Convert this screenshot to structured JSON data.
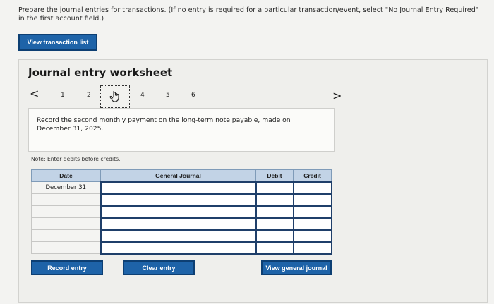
{
  "instructions": {
    "line1": "Prepare the journal entries for transactions. (If no entry is required for a particular transaction/event, select \"No Journal Entry Required\"",
    "line2": "in the first account field.)"
  },
  "buttons": {
    "view_transaction_list": "View transaction list",
    "record_entry": "Record entry",
    "clear_entry": "Clear entry",
    "view_general_journal": "View general journal"
  },
  "worksheet": {
    "title": "Journal entry worksheet",
    "prev": "<",
    "next": ">",
    "steps": [
      "1",
      "2",
      "3",
      "4",
      "5",
      "6"
    ],
    "current_step": "3",
    "question": "Record the second monthly payment on the long-term note payable, made on December 31, 2025.",
    "note": "Note: Enter debits before credits."
  },
  "journal": {
    "headers": {
      "date": "Date",
      "account": "General Journal",
      "debit": "Debit",
      "credit": "Credit"
    },
    "rows": [
      {
        "date": "December 31",
        "account": "",
        "debit": "",
        "credit": ""
      },
      {
        "date": "",
        "account": "",
        "debit": "",
        "credit": ""
      },
      {
        "date": "",
        "account": "",
        "debit": "",
        "credit": ""
      },
      {
        "date": "",
        "account": "",
        "debit": "",
        "credit": ""
      },
      {
        "date": "",
        "account": "",
        "debit": "",
        "credit": ""
      },
      {
        "date": "",
        "account": "",
        "debit": "",
        "credit": ""
      }
    ]
  },
  "icons": {
    "current_step": "pointer-hand-icon"
  },
  "colors": {
    "button": "#1e63a8",
    "header": "#c2d3e6",
    "input_border": "#1f3f6a"
  }
}
